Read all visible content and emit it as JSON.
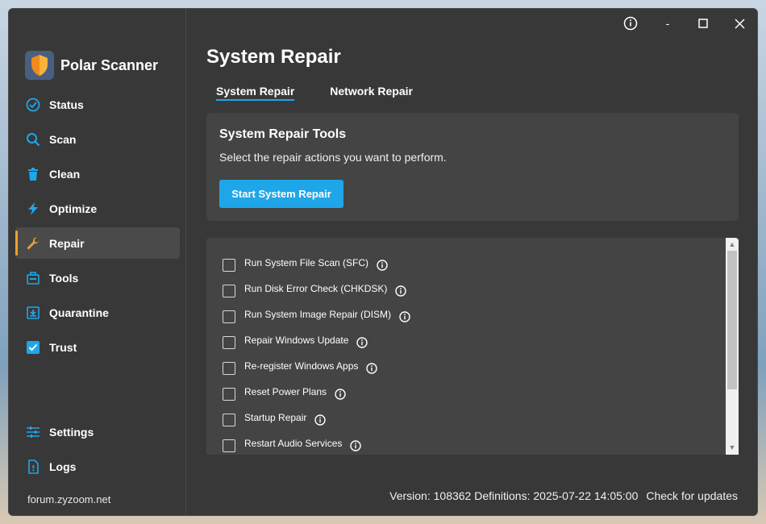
{
  "app": {
    "name": "Polar Scanner"
  },
  "titlebar": {
    "minimize_label": "-"
  },
  "sidebar": {
    "items": [
      {
        "id": "status",
        "label": "Status",
        "icon": "check-circle-icon"
      },
      {
        "id": "scan",
        "label": "Scan",
        "icon": "search-icon"
      },
      {
        "id": "clean",
        "label": "Clean",
        "icon": "trash-icon"
      },
      {
        "id": "optimize",
        "label": "Optimize",
        "icon": "lightning-icon"
      },
      {
        "id": "repair",
        "label": "Repair",
        "icon": "wrench-icon",
        "active": true
      },
      {
        "id": "tools",
        "label": "Tools",
        "icon": "toolbox-icon"
      },
      {
        "id": "quarantine",
        "label": "Quarantine",
        "icon": "quarantine-box-icon"
      },
      {
        "id": "trust",
        "label": "Trust",
        "icon": "checkbox-checked-icon"
      }
    ],
    "bottom_items": [
      {
        "id": "settings",
        "label": "Settings",
        "icon": "sliders-icon"
      },
      {
        "id": "logs",
        "label": "Logs",
        "icon": "log-file-icon"
      }
    ],
    "footer_link": "forum.zyzoom.net"
  },
  "main": {
    "title": "System Repair",
    "tabs": [
      {
        "label": "System Repair",
        "active": true
      },
      {
        "label": "Network Repair",
        "active": false
      }
    ],
    "tools_card": {
      "title": "System Repair Tools",
      "description": "Select the repair actions you want to perform.",
      "button_label": "Start System Repair"
    },
    "repair_items": [
      {
        "label": "Run System File Scan (SFC)",
        "checked": false
      },
      {
        "label": "Run Disk Error Check (CHKDSK)",
        "checked": false
      },
      {
        "label": "Run System Image Repair (DISM)",
        "checked": false
      },
      {
        "label": "Repair Windows Update",
        "checked": false
      },
      {
        "label": "Re-register Windows Apps",
        "checked": false
      },
      {
        "label": "Reset Power Plans",
        "checked": false
      },
      {
        "label": "Startup Repair",
        "checked": false
      },
      {
        "label": "Restart Audio Services",
        "checked": false
      }
    ]
  },
  "status_bar": {
    "version_text": "Version: 108362 Definitions: 2025-07-22 14:05:00",
    "update_link": "Check for updates"
  },
  "colors": {
    "accent": "#1fa6e8",
    "active_indicator": "#f0a030",
    "window_bg": "#383838",
    "card_bg": "#444444"
  }
}
